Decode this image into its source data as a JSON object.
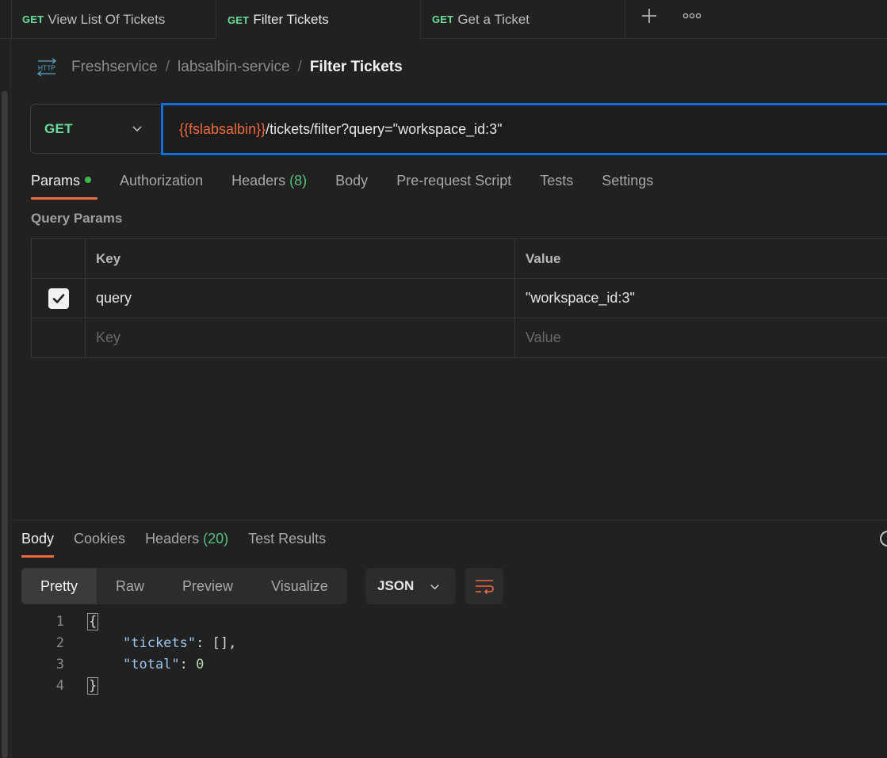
{
  "tabs": [
    {
      "method": "GET",
      "name": "View List Of Tickets",
      "active": false
    },
    {
      "method": "GET",
      "name": "Filter Tickets",
      "active": true
    },
    {
      "method": "GET",
      "name": "Get a Ticket",
      "active": false
    }
  ],
  "breadcrumb": {
    "icon_text": "HTTP",
    "items": [
      "Freshservice",
      "labsalbin-service"
    ],
    "current": "Filter Tickets",
    "separator": "/"
  },
  "request": {
    "method": "GET",
    "url_variable": "{{fslabsalbin}}",
    "url_path": "/tickets/filter?query=\"workspace_id:3\""
  },
  "request_tabs": {
    "params": "Params",
    "authorization": "Authorization",
    "headers": "Headers",
    "headers_count": "(8)",
    "body": "Body",
    "prerequest": "Pre-request Script",
    "tests": "Tests",
    "settings": "Settings"
  },
  "query_params": {
    "title": "Query Params",
    "columns": {
      "key": "Key",
      "value": "Value"
    },
    "rows": [
      {
        "checked": true,
        "key": "query",
        "value": "\"workspace_id:3\""
      }
    ],
    "placeholder": {
      "key": "Key",
      "value": "Value"
    }
  },
  "response_tabs": {
    "body": "Body",
    "cookies": "Cookies",
    "headers": "Headers",
    "headers_count": "(20)",
    "test_results": "Test Results"
  },
  "response_view": {
    "modes": [
      "Pretty",
      "Raw",
      "Preview",
      "Visualize"
    ],
    "active_mode": "Pretty",
    "format": "JSON"
  },
  "response_body": {
    "line_numbers": [
      "1",
      "2",
      "3",
      "4"
    ],
    "open_brace": "{",
    "close_brace": "}",
    "key_tickets": "\"tickets\"",
    "val_tickets": ": [],",
    "key_total": "\"total\"",
    "colon": ": ",
    "val_total": "0"
  },
  "colors": {
    "accent": "#ef6a3c",
    "method_get": "#6bdd9a",
    "url_focus": "#0b6fe0",
    "background": "#212121"
  }
}
